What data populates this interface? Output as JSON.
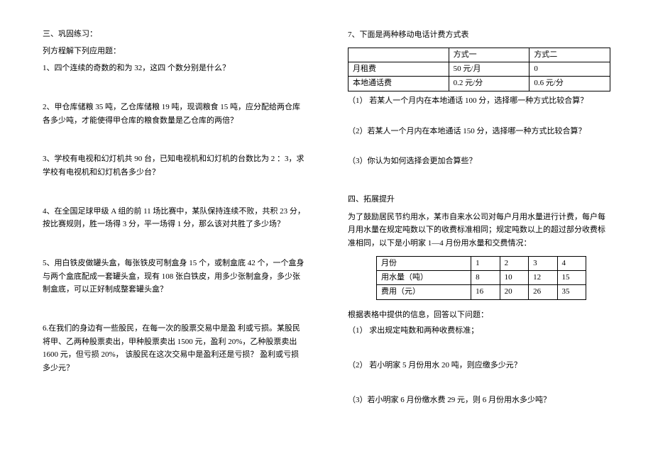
{
  "left": {
    "section_title": "三、巩固练习：",
    "list_heading": "列方程解下列应用题：",
    "p1": "1、四个连续的奇数的和为 32，这四 个数分别是什么？",
    "p2": "2、甲仓库储粮 35 吨，乙仓库储粮 19 吨，现调粮食 15 吨，应分配给两仓库各多少吨，才能使得甲仓库的粮食数量是乙仓库的两倍？",
    "p3": "3、学校有电视和幻灯机共 90 台，已知电视机和幻灯机的台数比为 2 ：3，求学校有电视机和幻灯机各多少台？",
    "p4": "4、在全国足球甲级 A 组的前 11 场比赛中，某队保持连续不败，共积 23 分，按比赛规则，胜一场得 3 分，平一场得 1 分，那么该对共胜了多少场？",
    "p5": "5、用白铁皮做罐头盒，每张铁皮可制盒身 15 个，或制盒底 42 个，一个盒身与两个盒底配成一套罐头盒，现有 108 张白铁皮，用多少张制盒身，多少张制盒底，可以正好制成整套罐头盒？",
    "p6": "6.在我们的身边有一些股民，在每一次的股票交易中是盈  利或亏损。某股民将甲、乙两种股票卖出，甲种股票卖出 1500 元，盈利 20%，乙种股票卖出 1600 元，但亏损 20%，  该股民在这次交易中是盈利还是亏损？  盈利或亏损多少元？"
  },
  "right": {
    "p7_title": "7、下面是两种移动电话计费方式表",
    "table7": {
      "h1": "",
      "h2": "方式一",
      "h3": "方式二",
      "r1c1": "月租费",
      "r1c2": "50 元/月",
      "r1c3": "0",
      "r2c1": "本地通话费",
      "r2c2": "0.2 元/分",
      "r2c3": "0.6 元/分"
    },
    "p7_q1": "（1）  若某人一个月内在本地通话 100 分，选择哪一种方式比较合算？",
    "p7_q2": "（2）若某人一个月内在本地通话 150 分，选择哪一种方式比较合算？",
    "p7_q3": "（3）你认为如何选择会更加合算些？",
    "section4_title": "四、拓展提升",
    "section4_intro": "    为了鼓励居民节约用水，某市自来水公司对每户月用水量进行计费，每户每月用水量在规定吨数以下的收费标准相同；规定吨数以上的超过部分收费标准相同，以下是小明家 1—4 月份用水量和交费情况：",
    "table4": {
      "r1c1": "月份",
      "r1c2": "1",
      "r1c3": "2",
      "r1c4": "3",
      "r1c5": "4",
      "r2c1": "用水量（吨）",
      "r2c2": "8",
      "r2c3": "10",
      "r2c4": "12",
      "r2c5": "15",
      "r3c1": "费用（元）",
      "r3c2": "16",
      "r3c3": "20",
      "r3c4": "26",
      "r3c5": "35"
    },
    "s4_after": "根据表格中提供的信息，回答以下问题：",
    "s4_q1": "（1）  求出规定吨数和两种收费标准；",
    "s4_q2": "（2）  若小明家 5 月份用水 20 吨，则应缴多少元？",
    "s4_q3": "（3）若小明家 6 月份缴水费 29 元，则 6 月份用水多少吨？"
  }
}
